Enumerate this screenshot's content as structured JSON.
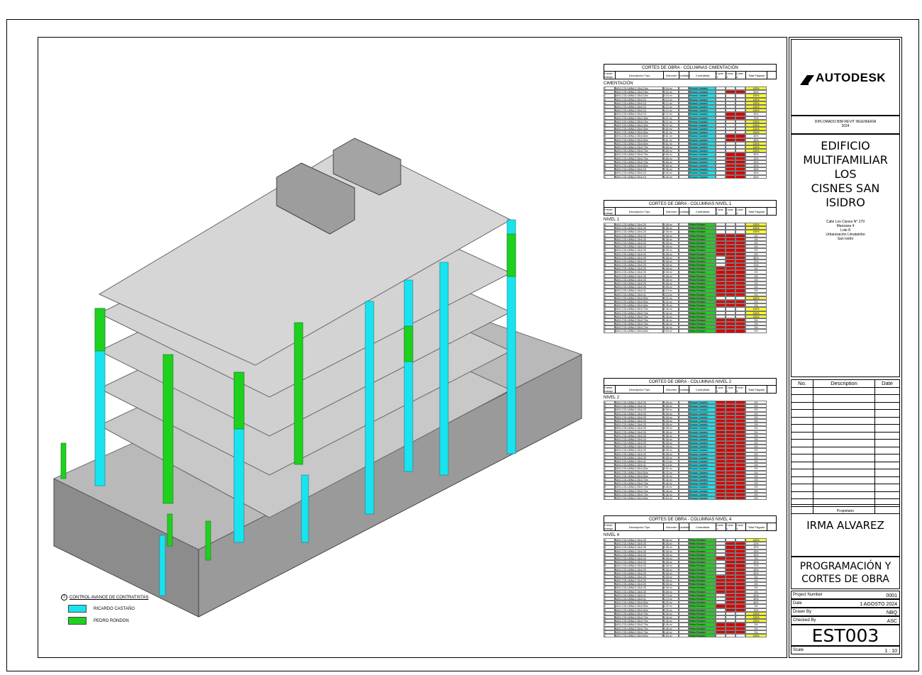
{
  "brand": "AUTODESK",
  "course": [
    "DIPLOMADO BIM REVIT INGENIERÍA",
    "2024"
  ],
  "project_title": [
    "EDIFICIO",
    "MULTIFAMILIAR LOS",
    "CISNES SAN ISIDRO"
  ],
  "address": [
    "Calle Los Cisnes N° 270",
    "Manzana 4",
    "Lote 8",
    "Urbanización Limatambo",
    "San Isidro"
  ],
  "revision_headers": {
    "no": "No.",
    "description": "Description",
    "date": "Date"
  },
  "owner_label": "Propietario",
  "owner": "IRMA ALVAREZ",
  "sheet_title": [
    "PROGRAMACIÓN Y",
    "CORTES DE OBRA"
  ],
  "info": {
    "project_number_label": "Project Number",
    "project_number": "0001",
    "date_label": "Date",
    "date": "1 AGOSTO 2024",
    "drawn_label": "Drawn By",
    "drawn": "NBQ",
    "checked_label": "Checked By",
    "checked": "ASC",
    "scale_label": "Scale",
    "scale": "1 : 10"
  },
  "sheet_number": "EST003",
  "legend": {
    "title": "CONTROL AVANCE DE CONTRATISTAS",
    "marker": "1",
    "items": [
      {
        "label": "RICARDO CASTAÑO",
        "color": "#19e3ef"
      },
      {
        "label": "PEDRO RONDON",
        "color": "#1fd11f"
      }
    ]
  },
  "colors": {
    "cyan": "#19e3ef",
    "green": "#1fd11f",
    "red": "#d90000",
    "yellow": "#ffff33"
  },
  "schedule_headers": [
    "Frente trabajo",
    "Descripción Tipo",
    "Volumen",
    "Cantidad",
    "Contratista",
    "Corte 1",
    "Corte 2",
    "Corte 3",
    "Total Pagado"
  ],
  "schedules": [
    {
      "title": "CORTES DE OBRA - COLUMNAS CIMENTACIÓN",
      "level": "CIMENTACIÓN",
      "contractor": "Ricardo Castaño",
      "rows": [
        {
          "f": "C",
          "d": "MXG-COLUMNA 0.15x0.15m",
          "v": "0.04 m³",
          "t": "100%",
          "s": "y"
        },
        {
          "f": "C",
          "d": "MXG-COLUMNA 0.15x0.15m",
          "v": "0.04 m³",
          "t": "50%",
          "s": "w"
        },
        {
          "f": "C",
          "d": "MXG-COLUMNA 0.15x0.15m",
          "v": "0.04 m³",
          "t": "100%",
          "s": "y"
        },
        {
          "f": "A",
          "d": "MXG-COLUMNA 0.25x0.15",
          "v": "0.12 m³",
          "t": "100%",
          "s": "y"
        },
        {
          "f": "A",
          "d": "MXG-COLUMNA 0.25x0.15",
          "v": "0.12 m³",
          "t": "100%",
          "s": "y"
        },
        {
          "f": "C",
          "d": "MXG-COLUMNA 0.25x0.15",
          "v": "0.12 m³",
          "t": "100%",
          "s": "y"
        },
        {
          "f": "C",
          "d": "MXG-COLUMNA 0.25x0.15",
          "v": "0.12 m³",
          "t": "100%",
          "s": "y"
        },
        {
          "f": "C",
          "d": "MXG-COLUMNA 0.25x0.15",
          "v": "0.12 m³",
          "t": "50%",
          "s": "w"
        },
        {
          "f": "C",
          "d": "MXG-COLUMNA 0.25x0.40m",
          "v": "0.37 m³",
          "t": "71%",
          "s": "w"
        },
        {
          "f": "A",
          "d": "MXG-COLUMNA 0.25x0.10m",
          "v": "0.37 m³",
          "t": "100%",
          "s": "y"
        },
        {
          "f": "B",
          "d": "MXG-COLUMNA 0.25x0.40m",
          "v": "0.37 m³",
          "t": "100%",
          "s": "y"
        },
        {
          "f": "C",
          "d": "MXG-COLUMNA 0.25x0.40m",
          "v": "0.60 m³",
          "t": "100%",
          "s": "y"
        },
        {
          "f": "B",
          "d": "MXG-COLUMNA 0.25x0.60m",
          "v": "0.61 m³",
          "t": "100%",
          "s": "y"
        },
        {
          "f": "B",
          "d": "MXG-COLUMNA 0.25x0.60m",
          "v": "0.61 m³",
          "t": "60%",
          "s": "w"
        },
        {
          "f": "B",
          "d": "MXG-COLUMNA 0.25x0.60m",
          "v": "0.61 m³",
          "t": "50%",
          "s": "w"
        },
        {
          "f": "B",
          "d": "MXG-COLUMNA 0.25x0.60m",
          "v": "0.61 m³",
          "t": "100%",
          "s": "y"
        },
        {
          "f": "A",
          "d": "MXG-COLUMNA 0.25x0.70m",
          "v": "0.65 m³",
          "t": "100%",
          "s": "y"
        },
        {
          "f": "B",
          "d": "MXG-COLUMNA 0.25x0.70m",
          "v": "0.65 m³",
          "t": "100%",
          "s": "y"
        },
        {
          "f": "C",
          "d": "MXG-COLUMNA 0.25x0.70m",
          "v": "0.65 m³",
          "t": "50%",
          "s": "w"
        },
        {
          "f": "C",
          "d": "MXG-COLUMNA 0.25x0.70m",
          "v": "0.65 m³",
          "t": "32%",
          "s": "w"
        },
        {
          "f": "C",
          "d": "MXG-COLUMNA 0.25x0.70m",
          "v": "0.65 m³",
          "t": "20%",
          "s": "w"
        },
        {
          "f": "B",
          "d": "MXG-COLUMNA 0.30x0.60m",
          "v": "0.65 m³",
          "t": "40%",
          "s": "w"
        },
        {
          "f": "B",
          "d": "MXG-COLUMNA 0.30x0.15",
          "v": "0.06 m³",
          "t": "30%",
          "s": "w"
        },
        {
          "f": "B",
          "d": "MXG-COLUMNA 0.25x0.15",
          "v": "0.06 m³",
          "t": "30%",
          "s": "w"
        },
        {
          "f": "C",
          "d": "MXG-COLUMNA 0.30x0.15",
          "v": "0.06 m³",
          "t": "50%",
          "s": "w"
        }
      ]
    },
    {
      "title": "CORTES DE OBRA - COLUMNAS NIVEL 1",
      "level": "NIVEL 1",
      "contractor": "Pedro Rondon",
      "rows": [
        {
          "f": "A",
          "d": "MXG-COLUMNA 0.15x0.25",
          "v": "0.08 m³",
          "t": "100%",
          "s": "y"
        },
        {
          "f": "A",
          "d": "MXG-COLUMNA 0.15x0.25",
          "v": "0.08 m³",
          "t": "100%",
          "s": "y"
        },
        {
          "f": "A",
          "d": "MXG-COLUMNA 0.15x0.25",
          "v": "0.08 m³",
          "t": "100%",
          "s": "y"
        },
        {
          "f": "A",
          "d": "MXG-COLUMNA 0.15x0.25",
          "v": "0.08 m³",
          "t": "0%",
          "s": "w"
        },
        {
          "f": "B",
          "d": "MXG-COLUMNA 0.15x0.25",
          "v": "0.08 m³",
          "t": "0%",
          "s": "w"
        },
        {
          "f": "B",
          "d": "MXG-COLUMNA 0.15x0.25",
          "v": "0.08 m³",
          "t": "0%",
          "s": "w"
        },
        {
          "f": "B",
          "d": "MXG-COLUMNA 0.15x0.25",
          "v": "0.08 m³",
          "t": "0%",
          "s": "w"
        },
        {
          "f": "B",
          "d": "MXG-COLUMNA 0.15x0.25",
          "v": "0.08 m³",
          "t": "0%",
          "s": "w"
        },
        {
          "f": "B",
          "d": "MXG-COLUMNA 0.15x0.25",
          "v": "0.08 m³",
          "t": "0%",
          "s": "w"
        },
        {
          "f": "B",
          "d": "MXG-COLUMNA 0.15x0.25",
          "v": "0.08 m³",
          "t": "80%",
          "s": "w"
        },
        {
          "f": "B",
          "d": "MXG-COLUMNA 0.15x0.25",
          "v": "0.08 m³",
          "t": "70%",
          "s": "w"
        },
        {
          "f": "B",
          "d": "MXG-COLUMNA 0.15x0.25",
          "v": "0.08 m³",
          "t": "70%",
          "s": "w"
        },
        {
          "f": "C",
          "d": "MXG-COLUMNA 0.15x0.25",
          "v": "0.08 m³",
          "t": "0%",
          "s": "w"
        },
        {
          "f": "C",
          "d": "MXG-COLUMNA 0.15x0.25",
          "v": "0.08 m³",
          "t": "0%",
          "s": "w"
        },
        {
          "f": "C",
          "d": "MXG-COLUMNA 0.15x0.25",
          "v": "0.08 m³",
          "t": "0%",
          "s": "w"
        },
        {
          "f": "C",
          "d": "MXG-COLUMNA 0.15x0.25",
          "v": "0.08 m³",
          "t": "0%",
          "s": "w"
        },
        {
          "f": "C",
          "d": "MXG-COLUMNA 0.15x0.25",
          "v": "0.08 m³",
          "t": "0%",
          "s": "w"
        },
        {
          "f": "C",
          "d": "MXG-COLUMNA 0.15x0.25",
          "v": "0.08 m³",
          "t": "0%",
          "s": "w"
        },
        {
          "f": "C",
          "d": "MXG-COLUMNA 0.15x0.41",
          "v": "0.13 m³",
          "t": "0%",
          "s": "w"
        },
        {
          "f": "C",
          "d": "MXG-COLUMNA 0.15x0.41",
          "v": "0.13 m³",
          "t": "0%",
          "s": "w"
        },
        {
          "f": "A",
          "d": "MXG-COLUMNA 0.25x0.50m",
          "v": "0.32 m³",
          "t": "100%",
          "s": "y"
        },
        {
          "f": "C",
          "d": "MXG-COLUMNA 0.25x0.50m",
          "v": "0.32 m³",
          "t": "0%",
          "s": "w"
        },
        {
          "f": "B",
          "d": "MXG-COLUMNA 0.25x0.60m",
          "v": "0.39 m³",
          "t": "0%",
          "s": "w"
        },
        {
          "f": "A",
          "d": "MXG-COLUMNA 0.25x0.70m",
          "v": "0.46 m³",
          "t": "100%",
          "s": "y"
        },
        {
          "f": "B",
          "d": "MXG-COLUMNA 0.25x0.70m",
          "v": "0.46 m³",
          "t": "100%",
          "s": "y"
        },
        {
          "f": "A",
          "d": "MXG-COLUMNA 0.25x0.70m",
          "v": "0.46 m³",
          "t": "100%",
          "s": "y"
        },
        {
          "f": "C",
          "d": "MXG-COLUMNA 0.25x0.70m",
          "v": "0.46 m³",
          "t": "0%",
          "s": "w"
        },
        {
          "f": "C",
          "d": "MXG-COLUMNA 0.25x0.70m",
          "v": "0.46 m³",
          "t": "0%",
          "s": "w"
        },
        {
          "f": "C",
          "d": "MXG-COLUMNA 0.25x0.70m",
          "v": "0.46 m³",
          "t": "0%",
          "s": "w"
        },
        {
          "f": "C",
          "d": "MXG-COLUMNA 0.30x0.60m",
          "v": "0.54 m³",
          "t": "0%",
          "s": "w"
        }
      ]
    },
    {
      "title": "CORTES DE OBRA - COLUMNAS NIVEL 2",
      "level": "NIVEL 2",
      "contractor": "Ricardo Castaño",
      "rows": [
        {
          "f": "A",
          "d": "MXG-COLUMNA 0.15x0.25",
          "v": "0.08 m³",
          "t": "0%",
          "s": "w"
        },
        {
          "f": "A",
          "d": "MXG-COLUMNA 0.15x0.25",
          "v": "0.08 m³",
          "t": "0%",
          "s": "w"
        },
        {
          "f": "B",
          "d": "MXG-COLUMNA 0.15x0.25",
          "v": "0.08 m³",
          "t": "0%",
          "s": "w"
        },
        {
          "f": "B",
          "d": "MXG-COLUMNA 0.15x0.25",
          "v": "0.08 m³",
          "t": "0%",
          "s": "w"
        },
        {
          "f": "B",
          "d": "MXG-COLUMNA 0.15x0.25",
          "v": "0.08 m³",
          "t": "0%",
          "s": "w"
        },
        {
          "f": "B",
          "d": "MXG-COLUMNA 0.15x0.25",
          "v": "0.08 m³",
          "t": "0%",
          "s": "w"
        },
        {
          "f": "B",
          "d": "MXG-COLUMNA 0.15x0.25",
          "v": "0.08 m³",
          "t": "0%",
          "s": "w"
        },
        {
          "f": "B",
          "d": "MXG-COLUMNA 0.15x0.25",
          "v": "0.08 m³",
          "t": "0%",
          "s": "w"
        },
        {
          "f": "B",
          "d": "MXG-COLUMNA 0.15x0.25",
          "v": "0.08 m³",
          "t": "0%",
          "s": "w"
        },
        {
          "f": "B",
          "d": "MXG-COLUMNA 0.15x0.25",
          "v": "0.08 m³",
          "t": "0%",
          "s": "w"
        },
        {
          "f": "B",
          "d": "MXG-COLUMNA 0.15x0.25",
          "v": "0.08 m³",
          "t": "0%",
          "s": "w"
        },
        {
          "f": "C",
          "d": "MXG-COLUMNA 0.15x0.25",
          "v": "0.08 m³",
          "t": "0%",
          "s": "w"
        },
        {
          "f": "C",
          "d": "MXG-COLUMNA 0.15x0.25",
          "v": "0.08 m³",
          "t": "0%",
          "s": "w"
        },
        {
          "f": "C",
          "d": "MXG-COLUMNA 0.15x0.25",
          "v": "0.08 m³",
          "t": "0%",
          "s": "w"
        },
        {
          "f": "C",
          "d": "MXG-COLUMNA 0.15x0.25",
          "v": "0.08 m³",
          "t": "0%",
          "s": "w"
        },
        {
          "f": "C",
          "d": "MXG-COLUMNA 0.15x0.25",
          "v": "0.08 m³",
          "t": "0%",
          "s": "w"
        },
        {
          "f": "C",
          "d": "MXG-COLUMNA 0.15x0.41",
          "v": "0.13 m³",
          "t": "0%",
          "s": "w"
        },
        {
          "f": "C",
          "d": "MXG-COLUMNA 0.15x0.41",
          "v": "0.13 m³",
          "t": "0%",
          "s": "w"
        },
        {
          "f": "A",
          "d": "MXG-COLUMNA 0.25x0.50m",
          "v": "0.32 m³",
          "t": "0%",
          "s": "w"
        },
        {
          "f": "C",
          "d": "MXG-COLUMNA 0.25x0.50m",
          "v": "0.32 m³",
          "t": "0%",
          "s": "w"
        },
        {
          "f": "B",
          "d": "MXG-COLUMNA 0.25x0.60m",
          "v": "0.39 m³",
          "t": "0%",
          "s": "w"
        },
        {
          "f": "A",
          "d": "MXG-COLUMNA 0.25x0.70m",
          "v": "0.46 m³",
          "t": "0%",
          "s": "w"
        },
        {
          "f": "A",
          "d": "MXG-COLUMNA 0.25x0.70m",
          "v": "0.46 m³",
          "t": "0%",
          "s": "w"
        },
        {
          "f": "B",
          "d": "MXG-COLUMNA 0.25x0.70m",
          "v": "0.46 m³",
          "t": "0%",
          "s": "w"
        },
        {
          "f": "C",
          "d": "MXG-COLUMNA 0.25x0.70m",
          "v": "0.46 m³",
          "t": "0%",
          "s": "w"
        },
        {
          "f": "C",
          "d": "MXG-COLUMNA 0.25x0.70m",
          "v": "0.46 m³",
          "t": "0%",
          "s": "w"
        },
        {
          "f": "C",
          "d": "MXG-COLUMNA 0.30x0.60m",
          "v": "0.54 m³",
          "t": "0%",
          "s": "w"
        }
      ]
    },
    {
      "title": "CORTES DE OBRA - COLUMNAS NIVEL 4",
      "level": "NIVEL 4",
      "contractor": "Pedro Rondon",
      "rows": [
        {
          "f": "A",
          "d": "MXG-COLUMNA 0.15x0.25",
          "v": "0.08 m³",
          "t": "100%",
          "s": "y"
        },
        {
          "f": "A",
          "d": "MXG-COLUMNA 0.15x0.25",
          "v": "0.08 m³",
          "t": "10%",
          "s": "w"
        },
        {
          "f": "B",
          "d": "MXG-COLUMNA 0.15x0.25",
          "v": "0.08 m³",
          "t": "20%",
          "s": "w"
        },
        {
          "f": "B",
          "d": "MXG-COLUMNA 0.15x0.25",
          "v": "0.08 m³",
          "t": "15%",
          "s": "w"
        },
        {
          "f": "B",
          "d": "MXG-COLUMNA 0.15x0.25",
          "v": "0.08 m³",
          "t": "30%",
          "s": "w"
        },
        {
          "f": "B",
          "d": "MXG-COLUMNA 0.15x0.25",
          "v": "0.08 m³",
          "t": "0%",
          "s": "w"
        },
        {
          "f": "B",
          "d": "MXG-COLUMNA 0.15x0.25",
          "v": "0.08 m³",
          "t": "40%",
          "s": "w"
        },
        {
          "f": "B",
          "d": "MXG-COLUMNA 0.15x0.25",
          "v": "0.08 m³",
          "t": "70%",
          "s": "w"
        },
        {
          "f": "B",
          "d": "MXG-COLUMNA 0.15x0.25",
          "v": "0.08 m³",
          "t": "50%",
          "s": "w"
        },
        {
          "f": "B",
          "d": "MXG-COLUMNA 0.15x0.25",
          "v": "0.08 m³",
          "t": "60%",
          "s": "w"
        },
        {
          "f": "C",
          "d": "MXG-COLUMNA 0.15x0.25",
          "v": "0.08 m³",
          "t": "0%",
          "s": "w"
        },
        {
          "f": "C",
          "d": "MXG-COLUMNA 0.15x0.25",
          "v": "0.08 m³",
          "t": "0%",
          "s": "w"
        },
        {
          "f": "C",
          "d": "MXG-COLUMNA 0.15x0.25",
          "v": "0.08 m³",
          "t": "0%",
          "s": "w"
        },
        {
          "f": "C",
          "d": "MXG-COLUMNA 0.15x0.25",
          "v": "0.08 m³",
          "t": "0%",
          "s": "w"
        },
        {
          "f": "C",
          "d": "MXG-COLUMNA 0.15x0.25",
          "v": "0.08 m³",
          "t": "0%",
          "s": "w"
        },
        {
          "f": "C",
          "d": "MXG-COLUMNA 0.15x0.41",
          "v": "0.13 m³",
          "t": "50%",
          "s": "w"
        },
        {
          "f": "C",
          "d": "MXG-COLUMNA 0.15x0.41",
          "v": "0.13 m³",
          "t": "50%",
          "s": "w"
        },
        {
          "f": "A",
          "d": "MXG-COLUMNA 0.25x0.50m",
          "v": "0.32 m³",
          "t": "80%",
          "s": "w"
        },
        {
          "f": "C",
          "d": "MXG-COLUMNA 0.25x0.50m",
          "v": "0.32 m³",
          "t": "0%",
          "s": "w"
        },
        {
          "f": "B",
          "d": "MXG-COLUMNA 0.25x0.60m",
          "v": "0.39 m³",
          "t": "70%",
          "s": "w"
        },
        {
          "f": "A",
          "d": "MXG-COLUMNA 0.25x0.70m",
          "v": "0.46 m³",
          "t": "100%",
          "s": "y"
        },
        {
          "f": "A",
          "d": "MXG-COLUMNA 0.25x0.70m",
          "v": "0.46 m³",
          "t": "100%",
          "s": "y"
        },
        {
          "f": "B",
          "d": "MXG-COLUMNA 0.25x0.70m",
          "v": "0.46 m³",
          "t": "100%",
          "s": "y"
        },
        {
          "f": "C",
          "d": "MXG-COLUMNA 0.25x0.70m",
          "v": "0.46 m³",
          "t": "0%",
          "s": "w"
        },
        {
          "f": "C",
          "d": "MXG-COLUMNA 0.25x0.70m",
          "v": "0.46 m³",
          "t": "0%",
          "s": "w"
        },
        {
          "f": "C",
          "d": "MXG-COLUMNA 0.25x0.70m",
          "v": "0.46 m³",
          "t": "0%",
          "s": "w"
        },
        {
          "f": "C",
          "d": "MXG-COLUMNA 0.30x0.60m",
          "v": "0.54 m³",
          "t": "100%",
          "s": "y"
        }
      ]
    }
  ]
}
